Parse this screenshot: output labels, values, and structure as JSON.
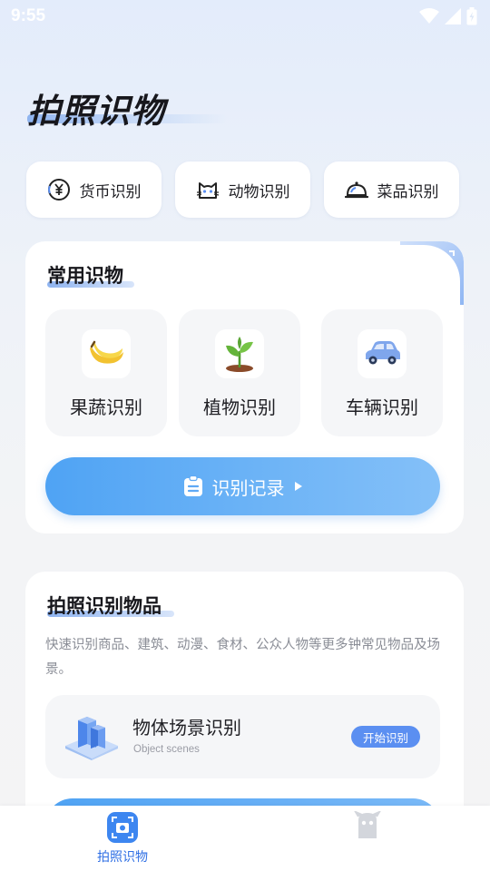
{
  "status_bar": {
    "time": "9:55"
  },
  "header": {
    "title": "拍照识物"
  },
  "quick_categories": [
    {
      "label": "货币识别",
      "icon": "currency-icon"
    },
    {
      "label": "动物识别",
      "icon": "cat-icon"
    },
    {
      "label": "菜品识别",
      "icon": "dish-cloche-icon"
    }
  ],
  "common": {
    "title": "常用识物",
    "tiles": [
      {
        "label": "果蔬识别",
        "icon": "banana-icon"
      },
      {
        "label": "植物识别",
        "icon": "sprout-icon"
      },
      {
        "label": "车辆识别",
        "icon": "car-icon"
      }
    ],
    "history_button": "识别记录"
  },
  "photo_section": {
    "title": "拍照识别物品",
    "description": "快速识别商品、建筑、动漫、食材、公众人物等更多钟常见物品及场景。",
    "scene": {
      "title": "物体场景识别",
      "subtitle": "Object scenes",
      "badge": "开始识别",
      "icon": "buildings-icon"
    }
  },
  "bottom_nav": {
    "items": [
      {
        "label": "拍照识物",
        "icon": "camera-scan-icon",
        "active": true
      },
      {
        "label": "",
        "icon": "profile-icon",
        "active": false
      }
    ]
  },
  "colors": {
    "accent": "#4fa3f4",
    "badge": "#5b8ff1",
    "nav_active": "#2f6fe4"
  }
}
